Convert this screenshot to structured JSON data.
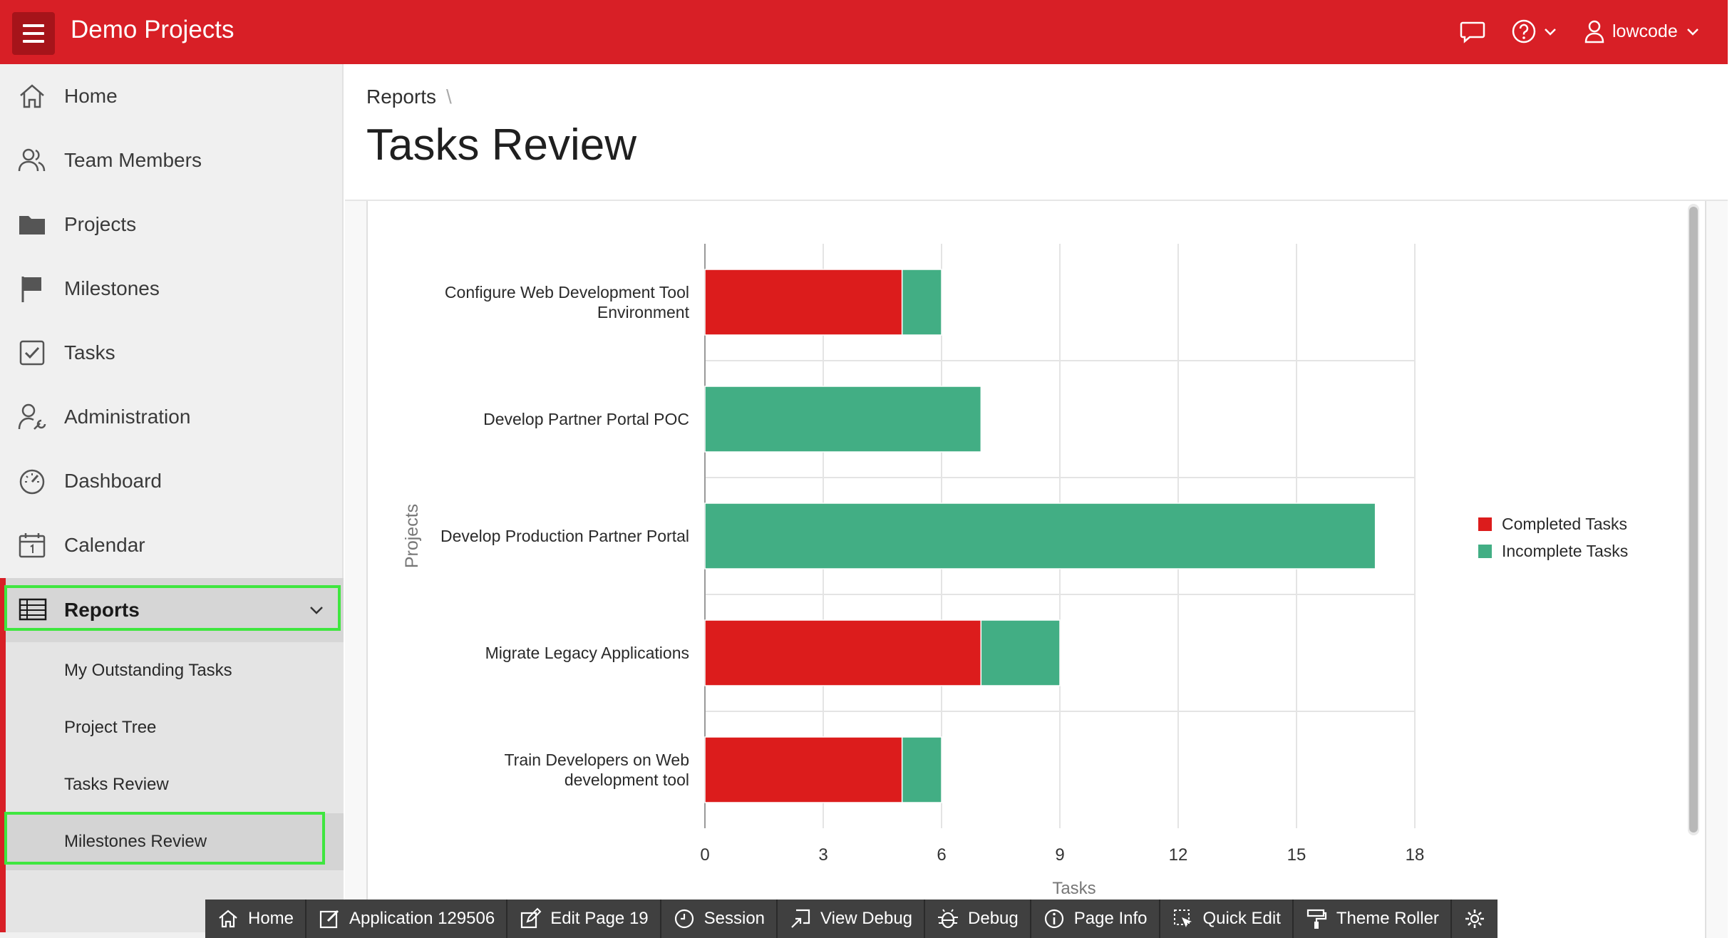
{
  "header": {
    "app_title": "Demo Projects",
    "username": "lowcode",
    "accent_color": "#d81f26",
    "icons": [
      "menu-icon",
      "chat-icon",
      "help-icon",
      "user-icon"
    ]
  },
  "sidebar": {
    "items": [
      {
        "label": "Home",
        "icon": "home-icon"
      },
      {
        "label": "Team Members",
        "icon": "users-icon"
      },
      {
        "label": "Projects",
        "icon": "folder-icon"
      },
      {
        "label": "Milestones",
        "icon": "flag-icon"
      },
      {
        "label": "Tasks",
        "icon": "checkbox-icon"
      },
      {
        "label": "Administration",
        "icon": "user-wrench-icon"
      },
      {
        "label": "Dashboard",
        "icon": "gauge-icon"
      },
      {
        "label": "Calendar",
        "icon": "calendar-icon"
      }
    ],
    "reports": {
      "label": "Reports",
      "icon": "table-icon",
      "subitems": [
        {
          "label": "My Outstanding Tasks"
        },
        {
          "label": "Project Tree"
        },
        {
          "label": "Tasks Review"
        },
        {
          "label": "Milestones Review"
        }
      ]
    }
  },
  "breadcrumb": {
    "parent": "Reports",
    "separator": "\\"
  },
  "page": {
    "title": "Tasks Review"
  },
  "chart_data": {
    "type": "bar",
    "orientation": "horizontal",
    "stacked": true,
    "categories": [
      "Configure Web Development Tool Environment",
      "Develop Partner Portal POC",
      "Develop Production Partner Portal",
      "Migrate Legacy Applications",
      "Train Developers on Web development tool"
    ],
    "category_lines": [
      [
        "Configure Web Development Tool",
        "Environment"
      ],
      [
        "Develop Partner Portal POC"
      ],
      [
        "Develop Production Partner Portal"
      ],
      [
        "Migrate Legacy Applications"
      ],
      [
        "Train Developers on Web",
        "development tool"
      ]
    ],
    "series": [
      {
        "name": "Completed Tasks",
        "color": "#dc1c1c",
        "values": [
          5,
          0,
          0,
          7,
          5
        ]
      },
      {
        "name": "Incomplete Tasks",
        "color": "#42ae84",
        "values": [
          1,
          7,
          17,
          2,
          1
        ]
      }
    ],
    "xlim": [
      0,
      18
    ],
    "xticks": [
      "0",
      "3",
      "6",
      "9",
      "12",
      "15",
      "18"
    ],
    "xlabel": "Tasks",
    "ylabel": "Projects",
    "grid": true,
    "legend": "right"
  },
  "devbar": {
    "items": [
      {
        "label": "Home",
        "icon": "home-icon"
      },
      {
        "label": "Application 129506",
        "icon": "edit-app-icon"
      },
      {
        "label": "Edit Page 19",
        "icon": "edit-icon"
      },
      {
        "label": "Session",
        "icon": "clock-icon"
      },
      {
        "label": "View Debug",
        "icon": "view-debug-icon"
      },
      {
        "label": "Debug",
        "icon": "bug-icon"
      },
      {
        "label": "Page Info",
        "icon": "info-icon"
      },
      {
        "label": "Quick Edit",
        "icon": "quick-edit-icon"
      },
      {
        "label": "Theme Roller",
        "icon": "paint-roller-icon"
      },
      {
        "label": "",
        "icon": "gear-icon"
      }
    ]
  }
}
